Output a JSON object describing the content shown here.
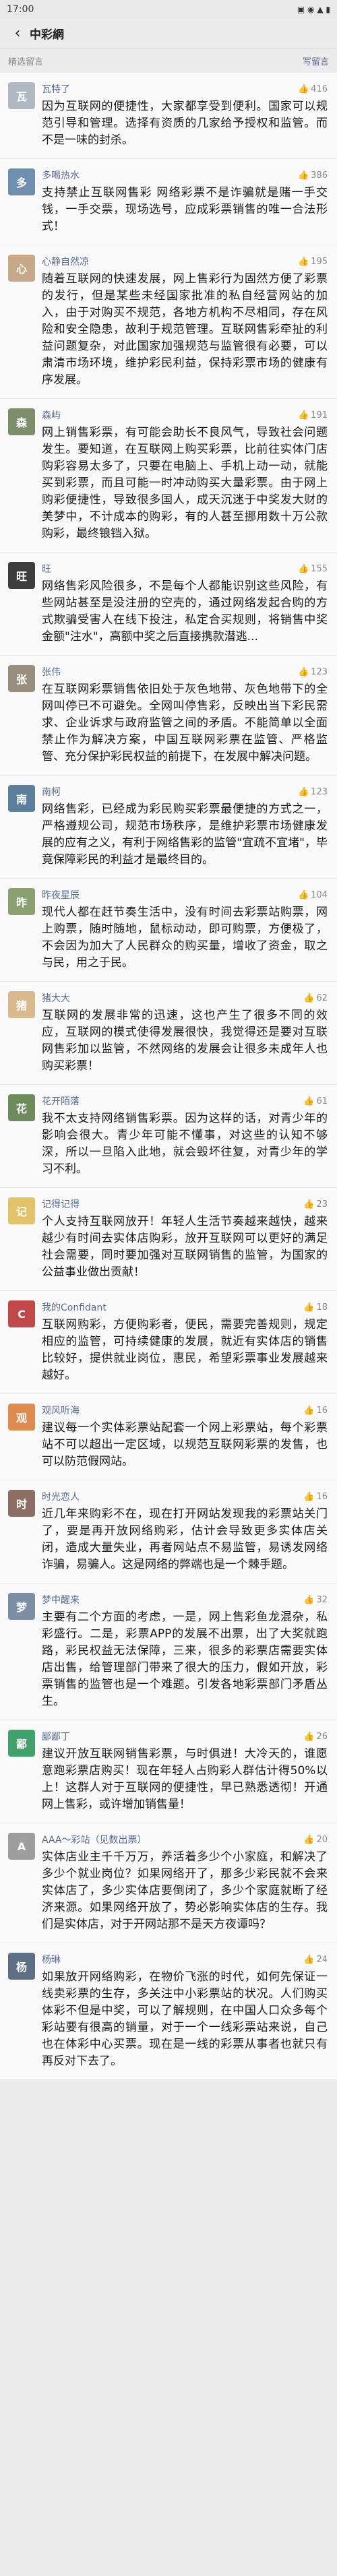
{
  "status": {
    "time": "17:00",
    "icons": "▣ ◉ ▲ ▮"
  },
  "appbar": {
    "back_icon": "back-arrow-icon",
    "title": "中彩網"
  },
  "subbar": {
    "left": "精选留言",
    "right": "写留言"
  },
  "comments": [
    {
      "name": "瓦特了",
      "likes": "416",
      "avatar_color": "#b0b8c4",
      "avatar_char": "瓦",
      "text": "因为互联网的便捷性，大家都享受到便利。国家可以规范引导和管理。选择有资质的几家给予授权和监管。而不是一味的封杀。"
    },
    {
      "name": "多喝热水",
      "likes": "386",
      "avatar_color": "#6f8fb0",
      "avatar_char": "多",
      "text": "支持禁止互联网售彩 网络彩票不是诈骗就是赌一手交钱，一手交票，现场选号，应成彩票销售的唯一合法形式！"
    },
    {
      "name": "心静自然凉",
      "likes": "195",
      "avatar_color": "#c7a98a",
      "avatar_char": "心",
      "text": "随着互联网的快速发展，网上售彩行为固然方便了彩票的发行，但是某些未经国家批准的私自经营网站的加入，由于对购买不规范，各地方机构不尽相同，存在风险和安全隐患，故利于规范管理。互联网售彩牵扯的利益问题复杂，对此国家加强规范与监管很有必要，可以肃清市场环境，维护彩民利益，保持彩票市场的健康有序发展。"
    },
    {
      "name": "森屿",
      "likes": "191",
      "avatar_color": "#7c8f6a",
      "avatar_char": "森",
      "text": "网上销售彩票，有可能会助长不良风气，导致社会问题发生。要知道，在互联网上购买彩票，比前往实体门店购彩容易太多了，只要在电脑上、手机上动一动，就能买到彩票，而且可能一时冲动购买大量彩票。由于网上购彩便捷性，导致很多国人，成天沉迷于中奖发大财的美梦中，不计成本的购彩，有的人甚至挪用数十万公款购彩，最终锒铛入狱。"
    },
    {
      "name": "旺",
      "likes": "155",
      "avatar_color": "#3d3d3d",
      "avatar_char": "旺",
      "text": "网络售彩风险很多，不是每个人都能识别这些风险，有些网站甚至是没注册的空壳的，通过网络发起合购的方式欺骗受害人在线下投注，私定合买规则，将销售中奖金额\"注水\"，高额中奖之后直接携款潜逃..."
    },
    {
      "name": "张伟",
      "likes": "123",
      "avatar_color": "#9a8f7e",
      "avatar_char": "张",
      "text": "在互联网彩票销售依旧处于灰色地带、灰色地带下的全网叫停已不可避免。全网叫停售彩，反映出当下彩民需求、企业诉求与政府监管之间的矛盾。不能简单以全面禁止作为解决方案，中国互联网彩票在监管、严格监管、充分保护彩民权益的前提下，在发展中解决问题。"
    },
    {
      "name": "南柯",
      "likes": "123",
      "avatar_color": "#5d7f9e",
      "avatar_char": "南",
      "text": "网络售彩，已经成为彩民购买彩票最便捷的方式之一，严格遵规公司，规范市场秩序，是维护彩票市场健康发展的应有之义，有利于网络售彩的监管\"宜疏不宜堵\"，毕竟保障彩民的利益才是最终目的。"
    },
    {
      "name": "昨夜星辰",
      "likes": "104",
      "avatar_color": "#8aa06f",
      "avatar_char": "昨",
      "text": "现代人都在赶节奏生活中，没有时间去彩票站购票，网上购票，随时随地，鼠标动动，即可购票，方便极了，不会因为加大了人民群众的购买量，增收了资金，取之与民，用之于民。"
    },
    {
      "name": "猪大大",
      "likes": "62",
      "avatar_color": "#d9b98d",
      "avatar_char": "猪",
      "text": "互联网的发展非常的迅速，这也产生了很多不同的效应，互联网的模式使得发展很快，我觉得还是要对互联网售彩加以监管，不然网络的发展会让很多未成年人也购买彩票！"
    },
    {
      "name": "花开陌落",
      "likes": "61",
      "avatar_color": "#6d8c5b",
      "avatar_char": "花",
      "text": "我不太支持网络销售彩票。因为这样的话，对青少年的影响会很大。青少年可能不懂事，对这些的认知不够深，所以一旦陷入此地，就会毁坏往复，对青少年的学习不利。"
    },
    {
      "name": "记得记得",
      "likes": "23",
      "avatar_color": "#e2c36a",
      "avatar_char": "记",
      "text": "个人支持互联网放开！年轻人生活节奏越来越快，越来越少有时间去实体店购彩，放开互联网可以更好的满足社会需要，同时要加强对互联网销售的监管，为国家的公益事业做出贡献！"
    },
    {
      "name": "我的Confidant",
      "likes": "18",
      "avatar_color": "#c04848",
      "avatar_char": "C",
      "text": "互联网购彩，方便购彩者，便民，需要完善规则，规定相应的监管，可持续健康的发展，就近有实体店的销售比较好，提供就业岗位，惠民，希望彩票事业发展越来越好。"
    },
    {
      "name": "观风听海",
      "likes": "16",
      "avatar_color": "#e08b4f",
      "avatar_char": "观",
      "text": "建议每一个实体彩票站配套一个网上彩票站，每个彩票站不可以超出一定区域，以规范互联网彩票的发售，也可以防范假网站。"
    },
    {
      "name": "时光恋人",
      "likes": "16",
      "avatar_color": "#8d6e63",
      "avatar_char": "时",
      "text": "近几年来购彩不在，现在打开网站发现我的彩票站关门了，要是再开放网络购彩，估计会导致更多实体店关闭，造成大量失业，再者网站点不易监管，易诱发网络诈骗，易骗人。这是网络的弊端也是一个棘手题。"
    },
    {
      "name": "梦中醒来",
      "likes": "32",
      "avatar_color": "#7a8fa3",
      "avatar_char": "梦",
      "text": "主要有二个方面的考虑，一是，网上售彩鱼龙混杂，私彩盛行。二是，彩票APP的发展不出票，出了大奖就跑路，彩民权益无法保障，三来，很多的彩票店需要实体店出售，给管理部门带来了很大的压力，假如开放，彩票销售的监管也是一个难题。引发各地彩票部门矛盾丛生。"
    },
    {
      "name": "鄙鄙丁",
      "likes": "26",
      "avatar_color": "#3fa36b",
      "avatar_char": "鄙",
      "text": "建议开放互联网销售彩票，与时俱进！大冷天的，谁愿意跑彩票店购买！现在年轻人占购彩人群估计得50%以上！这群人对于互联网的便捷性，早已熟悉透彻！开通网上售彩，或许增加销售量！"
    },
    {
      "name": "AAA～彩站（见数出票）",
      "likes": "20",
      "avatar_color": "#9e9e9e",
      "avatar_char": "A",
      "text": "实体店业主千千万万，养活着多少个小家庭，和解决了多少个就业岗位？如果网络开了，那多少彩民就不会来实体店了，多少实体店要倒闭了，多少个家庭就断了经济来源。如果网络开放了，势必影响实体店的生存。我们是实体店，对于开网站那不是天方夜谭吗？"
    },
    {
      "name": "杨琳",
      "likes": "24",
      "avatar_color": "#5c6f84",
      "avatar_char": "杨",
      "text": "如果放开网络购彩，在物价飞涨的时代，如何先保证一线卖彩票的生存，多关注中小彩票站的状况。人们购买体彩不但是中奖，可以了解规则，在中国人口众多每个彩站要有很高的销量，对于一个一线彩票站来说，自己也在体彩中心买票。现在是一线的彩票从事者也就只有再反对下去了。"
    }
  ]
}
